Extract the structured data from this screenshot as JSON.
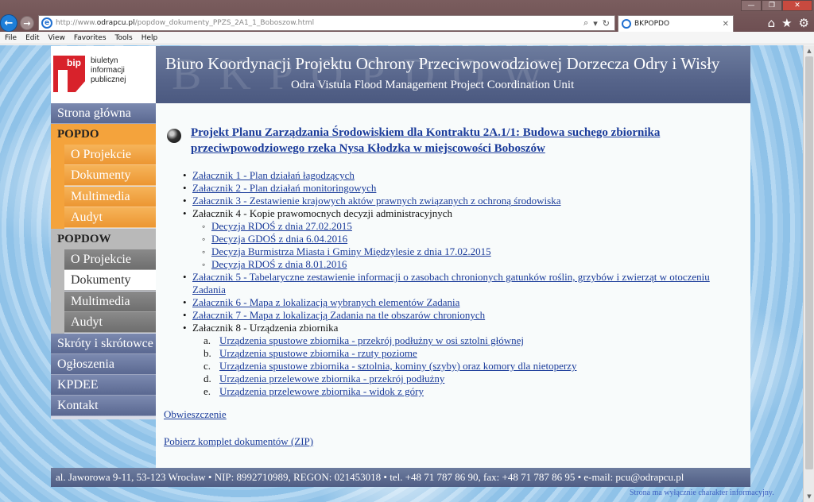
{
  "browser": {
    "url_prefix": "http://www.",
    "url_domain": "odrapcu.pl",
    "url_path": "/popdow_dokumenty_PPZS_2A1_1_Boboszow.html",
    "tab_title": "BKPOPDO",
    "menu": [
      "File",
      "Edit",
      "View",
      "Favorites",
      "Tools",
      "Help"
    ]
  },
  "header": {
    "bip_line1": "biuletyn",
    "bip_line2": "informacji publicznej",
    "bip_mark": "bip",
    "watermark": "BKPOPDOW",
    "title": "Biuro Koordynacji Projektu Ochrony Przeciwpowodziowej Dorzecza Odry i Wisły",
    "subtitle": "Odra Vistula Flood Management Project Coordination Unit"
  },
  "sidebar": {
    "home": "Strona główna",
    "popdo": "POPDO",
    "popdo_items": [
      "O Projekcie",
      "Dokumenty",
      "Multimedia",
      "Audyt"
    ],
    "popdow": "POPDOW",
    "popdow_items": [
      "O Projekcie",
      "Dokumenty",
      "Multimedia",
      "Audyt"
    ],
    "bottom_items": [
      "Skróty i skrótowce",
      "Ogłoszenia",
      "KPDEE",
      "Kontakt"
    ]
  },
  "content": {
    "heading": "Projekt Planu Zarządzania Środowiskiem dla Kontraktu 2A.1/1: Budowa suchego zbiornika przeciwpowodziowego rzeka Nysa Kłodzka w miejscowości Boboszów",
    "att1": "Załacznik 1 - Plan działań łagodzących",
    "att2": "Załacznik 2 - Plan działań monitoringowych",
    "att3": "Załacznik 3 - Zestawienie krajowych aktów prawnych związanych z ochroną środowiska",
    "att4": "Załacznik 4 - Kopie prawomocnych decyzji administracyjnych",
    "att4_items": [
      "Decyzja RDOŚ z dnia 27.02.2015",
      "Decyzja GDOŚ z dnia 6.04.2016",
      "Decyzja Burmistrza Miasta i Gminy Międzylesie z dnia 17.02.2015",
      "Decyzja RDOŚ z dnia 8.01.2016"
    ],
    "att5": "Załacznik 5 - Tabelaryczne zestawienie informacji o zasobach chronionych gatunków roślin, grzybów i zwierząt w otoczeniu Zadania",
    "att6": "Załacznik 6 - Mapa z lokalizacją wybranych elementów Zadania",
    "att7": "Załacznik 7 - Mapa z lokalizacją Zadania na tle obszarów chronionych",
    "att8": "Załacznik 8 - Urządzenia zbiornika",
    "att8_markers": [
      "a.",
      "b.",
      "c.",
      "d.",
      "e."
    ],
    "att8_items": [
      "Urządzenia spustowe zbiornika - przekrój podłużny w osi sztolni głównej",
      "Urządzenia spustowe zbiornika - rzuty poziome",
      "Urządzenia spustowe zbiornika - sztolnia, kominy (szyby) oraz komory dla nietoperzy",
      "Urządzenia przelewowe zbiornika - przekrój podłużny",
      "Urządzenia przelewowe zbiornika - widok z góry"
    ],
    "obwieszczenie": "Obwieszczenie",
    "zip": "Pobierz komplet dokumentów (ZIP)"
  },
  "footer": {
    "text": "al. Jaworowa 9-11, 53-123 Wrocław • NIP: 8992710989, REGON: 021453018 • tel. +48 71 787 86 90, fax: +48 71 787 86 95 • e-mail: pcu@odrapcu.pl",
    "disclaimer": "Strona ma wyłącznie charakter informacyjny."
  },
  "colors": {
    "banner": "#5d6b91",
    "orange": "#f4a33c",
    "gray": "#7a7a7a",
    "link": "#1a3b9a"
  }
}
